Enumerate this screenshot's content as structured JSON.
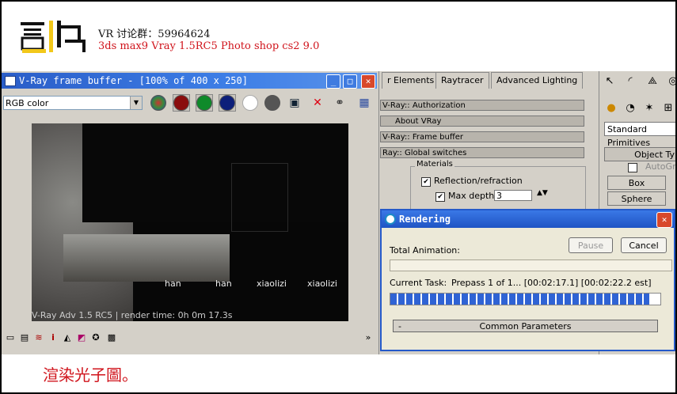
{
  "header": {
    "logo_text": "画山",
    "line1": "VR 讨论群：59964624",
    "line2": "3ds max9 Vray 1.5RC5 Photo shop cs2 9.0"
  },
  "vfb": {
    "title": "V-Ray frame buffer - [100% of 400 x 250]",
    "channel": "RGB color",
    "status": "V-Ray Adv 1.5 RC5 | render time: 0h 0m 17.3s",
    "labels": [
      "han",
      "han",
      "xiaolizi",
      "xiaolizi"
    ]
  },
  "tabs": [
    "r Elements",
    "Raytracer",
    "Advanced Lighting"
  ],
  "rollouts": [
    "V-Ray:: Authorization",
    "About VRay",
    "V-Ray:: Frame buffer",
    "Ray:: Global switches"
  ],
  "materials": {
    "group": "Materials",
    "reflection": "Reflection/refraction",
    "max_depth_label": "Max depth",
    "max_depth": "3"
  },
  "cmd_panel": {
    "dropdown": "Standard Primitives",
    "rollout": "Object Ty",
    "autogrid": "AutoGrid",
    "box": "Box",
    "sphere": "Sphere"
  },
  "rendering": {
    "title": "Rendering",
    "pause": "Pause",
    "cancel": "Cancel",
    "total_label": "Total Animation:",
    "current_label": "Current Task:",
    "current_task": "Prepass 1 of 1... [00:02:17.1] [00:02:22.2 est]",
    "progress": 0.96,
    "common_params": "Common Parameters",
    "minus": "-"
  },
  "caption": "渲染光子圖。"
}
